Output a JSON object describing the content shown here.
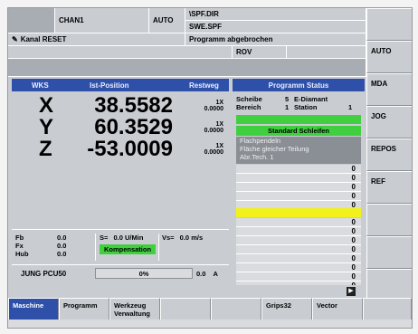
{
  "top": {
    "channel": "CHAN1",
    "mode": "AUTO",
    "program_path_1": "\\SPF.DIR",
    "program_path_2": "SWE.SPF",
    "channel_status": "Kanal RESET",
    "program_status": "Programm abgebrochen",
    "rov": "ROV"
  },
  "position": {
    "header": {
      "wks": "WKS",
      "ist": "Ist-Position",
      "rest": "Restweg"
    },
    "axes": [
      {
        "name": "X",
        "value": "38.5582",
        "scale": "1X",
        "rest": "0.0000"
      },
      {
        "name": "Y",
        "value": "60.3529",
        "scale": "1X",
        "rest": "0.0000"
      },
      {
        "name": "Z",
        "value": "-53.0009",
        "scale": "1X",
        "rest": "0.0000"
      }
    ]
  },
  "feed": {
    "fb_label": "Fb",
    "fb_val": "0.0",
    "fx_label": "Fx",
    "fx_val": "0.0",
    "hub_label": "Hub",
    "hub_val": "0.0",
    "s_label": "S=",
    "s_val": "0.0",
    "s_unit": "U/Min",
    "vs_label": "Vs=",
    "vs_val": "0.0",
    "vs_unit": "m/s",
    "kompensation": "Kompensation",
    "pcu": "JUNG PCU50",
    "percent": "0%",
    "current": "0.0",
    "current_unit": "A"
  },
  "status": {
    "title": "Programm Status",
    "scheibe_label": "Scheibe",
    "scheibe_num": "5",
    "scheibe_val": "E-Diamant",
    "bereich_label": "Bereich",
    "bereich_num": "1",
    "station_label": "Station",
    "station_num": "1",
    "standard": "Standard Schleifen",
    "line1": "Flachpendeln",
    "line2": "Fläche gleicher Teilung",
    "line3": "Abr.Tech. 1",
    "values": [
      "0",
      "0",
      "0",
      "0",
      "0",
      "0",
      "0",
      "0",
      "0",
      "0",
      "0",
      "0",
      "0"
    ]
  },
  "right_softkeys": [
    "",
    "AUTO",
    "MDA",
    "JOG",
    "REPOS",
    "REF",
    "",
    "",
    ""
  ],
  "bottom_softkeys": [
    "Maschine",
    "Programm",
    "Werkzeug\nVerwaltung",
    "",
    "",
    "Grips32",
    "Vector",
    ""
  ],
  "colors": {
    "accent": "#2e50a8",
    "green": "#3fcf3f",
    "yellow": "#f2f21a",
    "panel": "#c9cdd2"
  }
}
